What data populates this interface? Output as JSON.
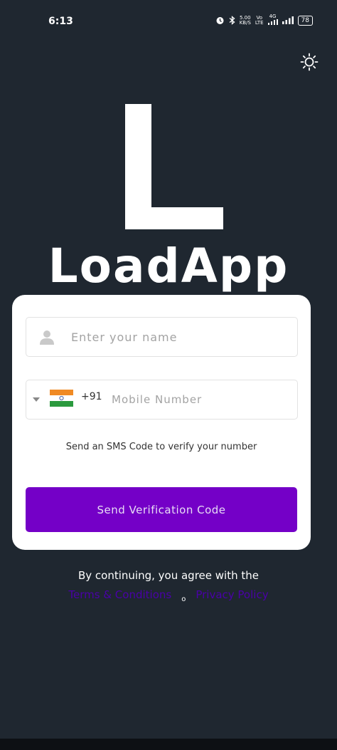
{
  "status_bar": {
    "time": "6:13",
    "speed_value": "5.00",
    "speed_unit": "KB/S",
    "volte_top": "Vo",
    "volte_bottom": "LTE",
    "network": "4G",
    "battery": "78"
  },
  "branding": {
    "logo_letter": "L",
    "app_name": "LoadApp"
  },
  "form": {
    "name_placeholder": "Enter your name",
    "dial_code": "+91",
    "phone_placeholder": "Mobile Number",
    "sms_hint": "Send an SMS Code to verify your number",
    "send_button_label": "Send Verification Code"
  },
  "footer": {
    "agree_text": "By continuing, you agree with the",
    "terms_link": "Terms & Conditions",
    "separator": "o",
    "privacy_link": "Privacy Policy"
  },
  "colors": {
    "background": "#1f2730",
    "card": "#ffffff",
    "primary_button": "#7400c7",
    "link": "#4a00a8"
  }
}
